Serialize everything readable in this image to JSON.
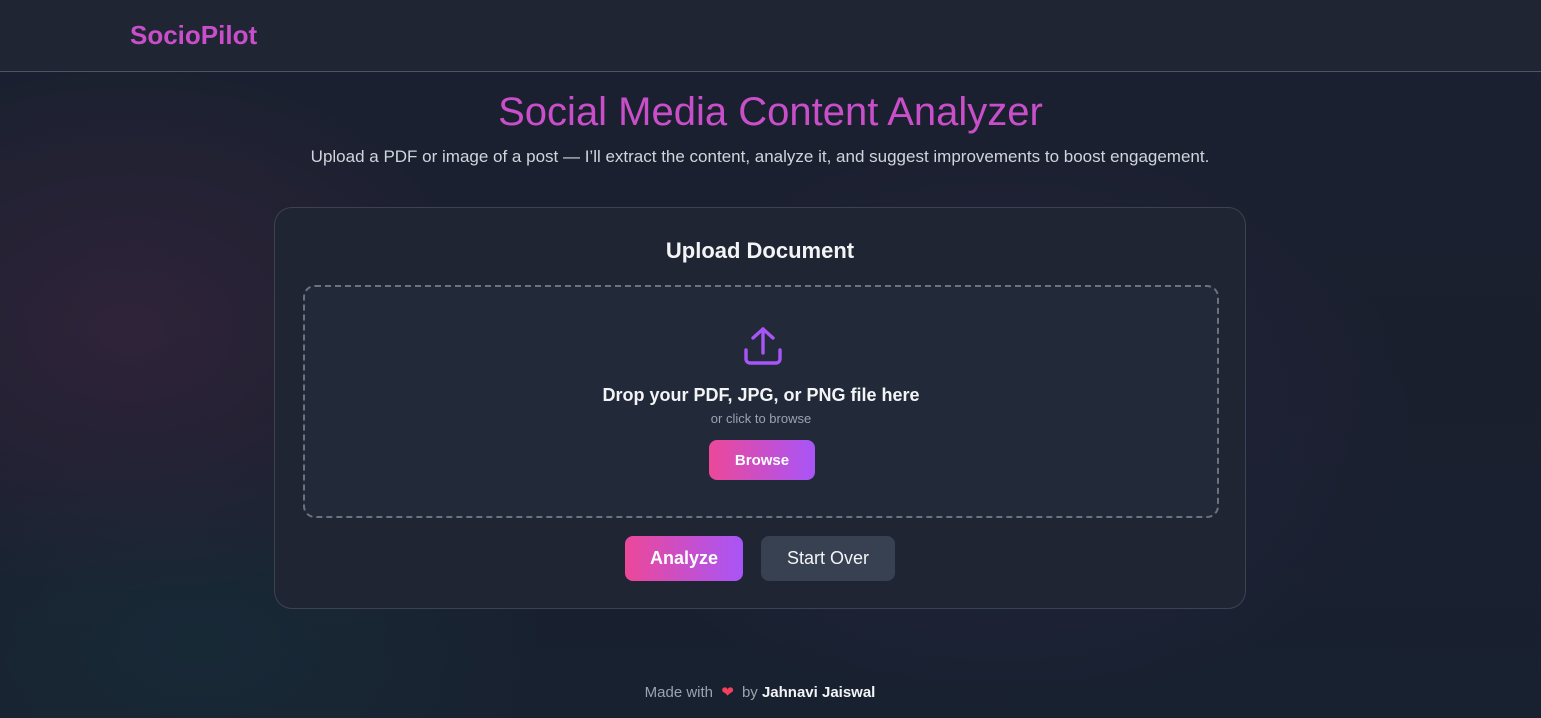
{
  "navbar": {
    "brand": "SocioPilot"
  },
  "header": {
    "title": "Social Media Content Analyzer",
    "subtitle": "Upload a PDF or image of a post — I’ll extract the content, analyze it, and suggest improvements to boost engagement."
  },
  "upload_card": {
    "title": "Upload Document",
    "dropzone": {
      "icon": "upload-icon",
      "primary_text": "Drop your PDF, JPG, or PNG file here",
      "secondary_text": "or click to browse",
      "browse_label": "Browse"
    },
    "actions": {
      "analyze_label": "Analyze",
      "reset_label": "Start Over"
    }
  },
  "footer": {
    "made_with": "Made with",
    "heart": "❤",
    "by": "by",
    "author": "Jahnavi Jaiswal"
  },
  "colors": {
    "brand": "#c84fc9",
    "accent_gradient_start": "#ec4899",
    "accent_gradient_end": "#a855f7",
    "icon": "#a855f7"
  }
}
